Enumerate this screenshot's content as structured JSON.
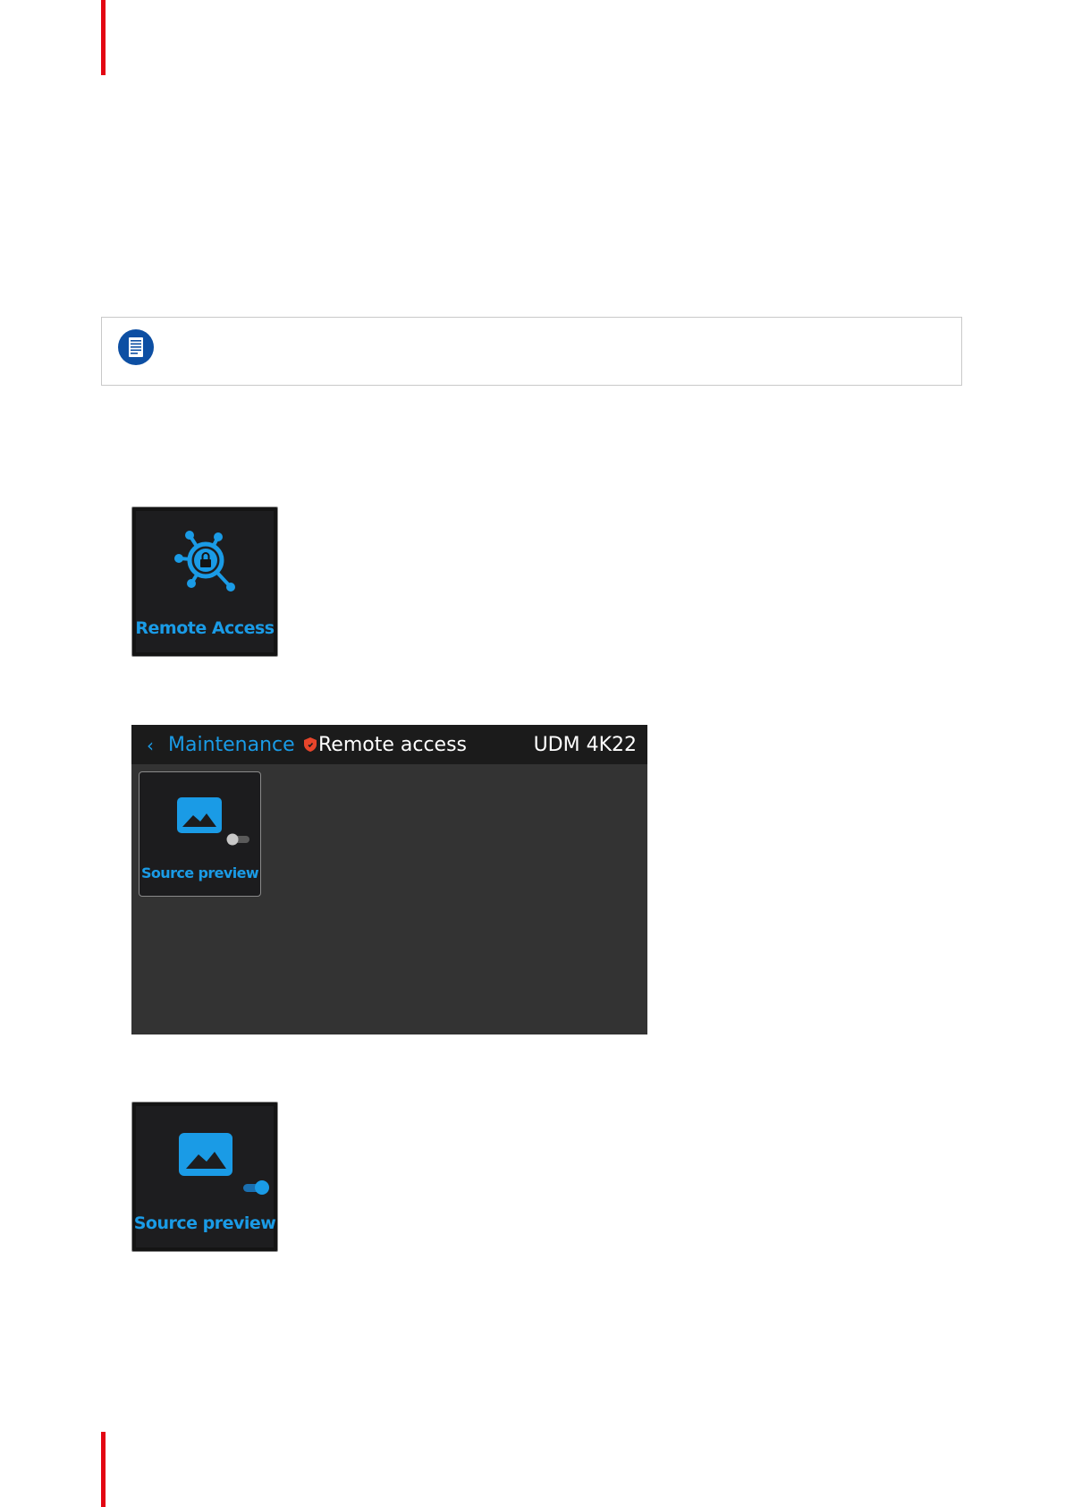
{
  "page": {
    "accent_color": "#e30613"
  },
  "note": {
    "icon": "note-document-icon"
  },
  "remote_access_tile": {
    "label": "Remote Access",
    "icon": "network-lock-icon",
    "color": "#1a9be6"
  },
  "remote_access_screen": {
    "back_icon": "chevron-left-icon",
    "back_label": "Maintenance",
    "shield_icon": "shield-icon",
    "title": "Remote access",
    "device": "UDM 4K22",
    "tiles": [
      {
        "label": "Source preview",
        "icon": "image-icon",
        "toggle_on": false
      }
    ]
  },
  "source_preview_tile": {
    "label": "Source preview",
    "icon": "image-icon",
    "toggle_on": true
  }
}
